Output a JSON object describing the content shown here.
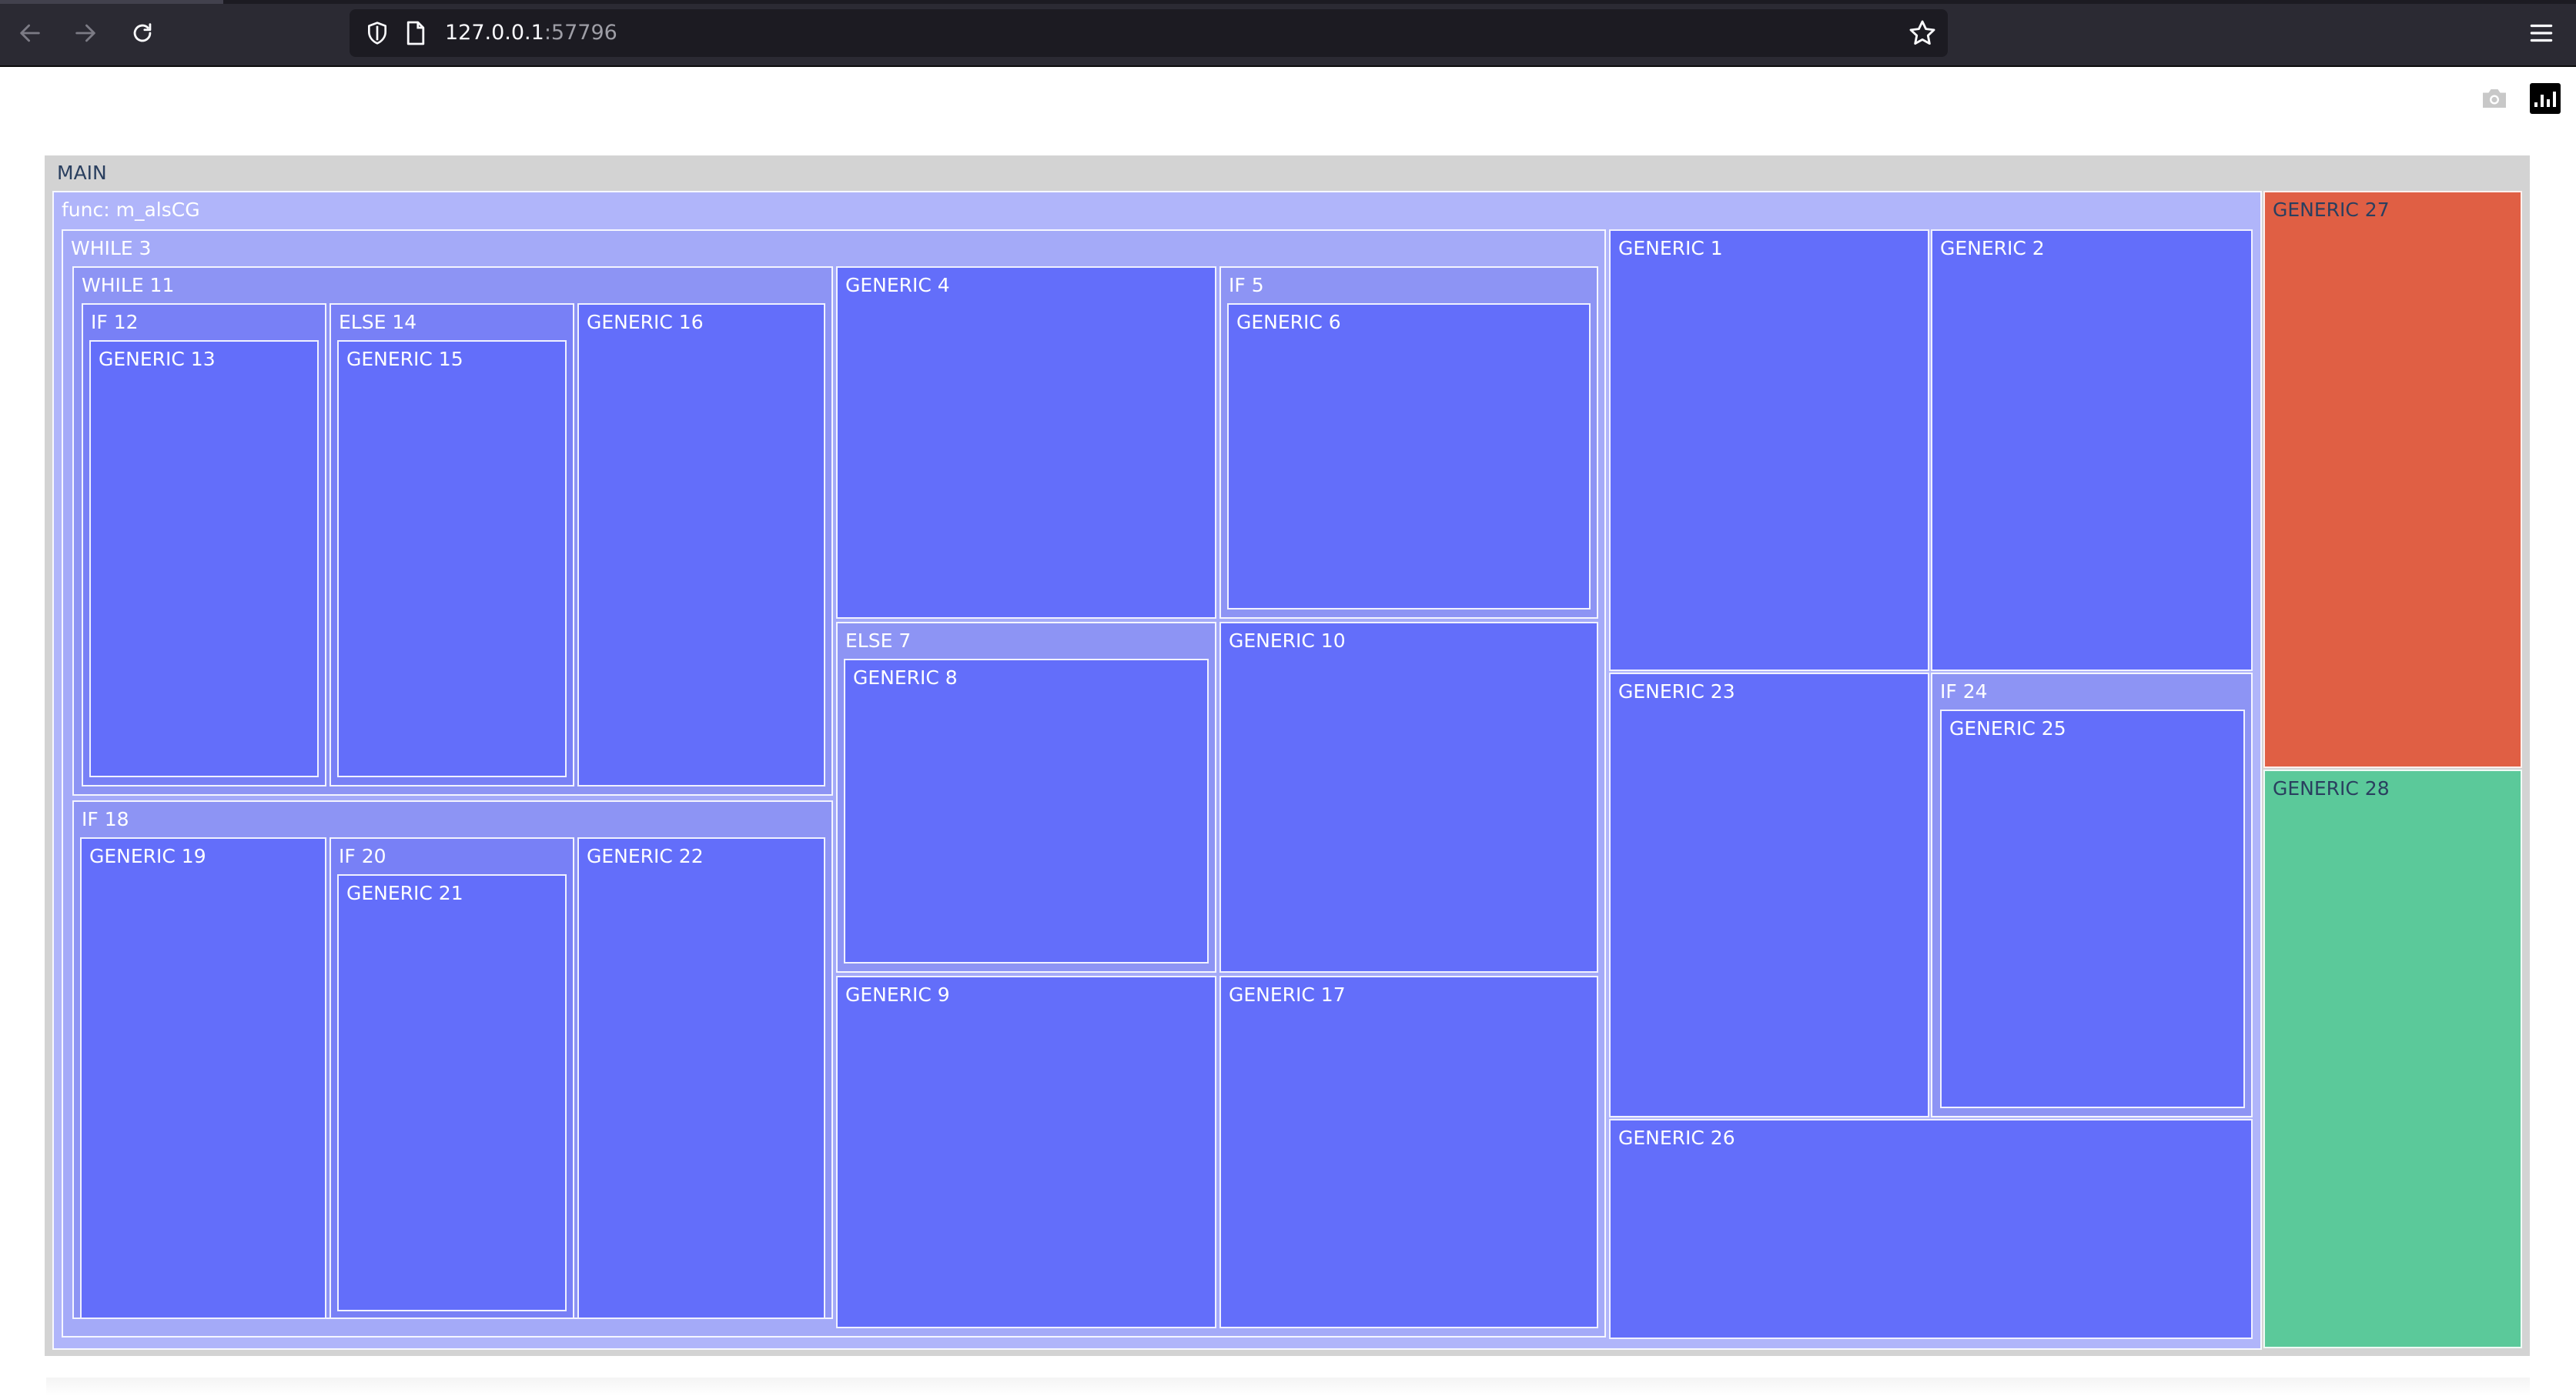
{
  "browser": {
    "url_host": "127.0.0.1",
    "url_port": ":57796",
    "icons": [
      "back-arrow-icon",
      "forward-arrow-icon",
      "reload-icon",
      "shield-icon",
      "page-icon",
      "star-icon",
      "hamburger-menu-icon"
    ]
  },
  "modebar": {
    "icons": [
      "camera-icon",
      "plotly-logo-icon"
    ]
  },
  "colors": {
    "root": "#d3d3d3",
    "func": "#b0b5fa",
    "level2": "#a4aaf8",
    "level3": "#8d94f4",
    "leaf": "#636efa",
    "generic27": "#e05f44",
    "generic28": "#5bc99a"
  },
  "treemap": {
    "main": "MAIN",
    "func": "func: m_alsCG",
    "while3": "WHILE 3",
    "while11": "WHILE 11",
    "if12": "IF 12",
    "generic13": "GENERIC 13",
    "else14": "ELSE 14",
    "generic15": "GENERIC 15",
    "generic16": "GENERIC 16",
    "if18": "IF 18",
    "generic19": "GENERIC 19",
    "if20": "IF 20",
    "generic21": "GENERIC 21",
    "generic22": "GENERIC 22",
    "generic4": "GENERIC 4",
    "if5": "IF 5",
    "generic6": "GENERIC 6",
    "else7": "ELSE 7",
    "generic8": "GENERIC 8",
    "generic10": "GENERIC 10",
    "generic9": "GENERIC 9",
    "generic17": "GENERIC 17",
    "generic1": "GENERIC 1",
    "generic2": "GENERIC 2",
    "generic23": "GENERIC 23",
    "if24": "IF 24",
    "generic25": "GENERIC 25",
    "generic26": "GENERIC 26",
    "generic27": "GENERIC 27",
    "generic28": "GENERIC 28"
  }
}
